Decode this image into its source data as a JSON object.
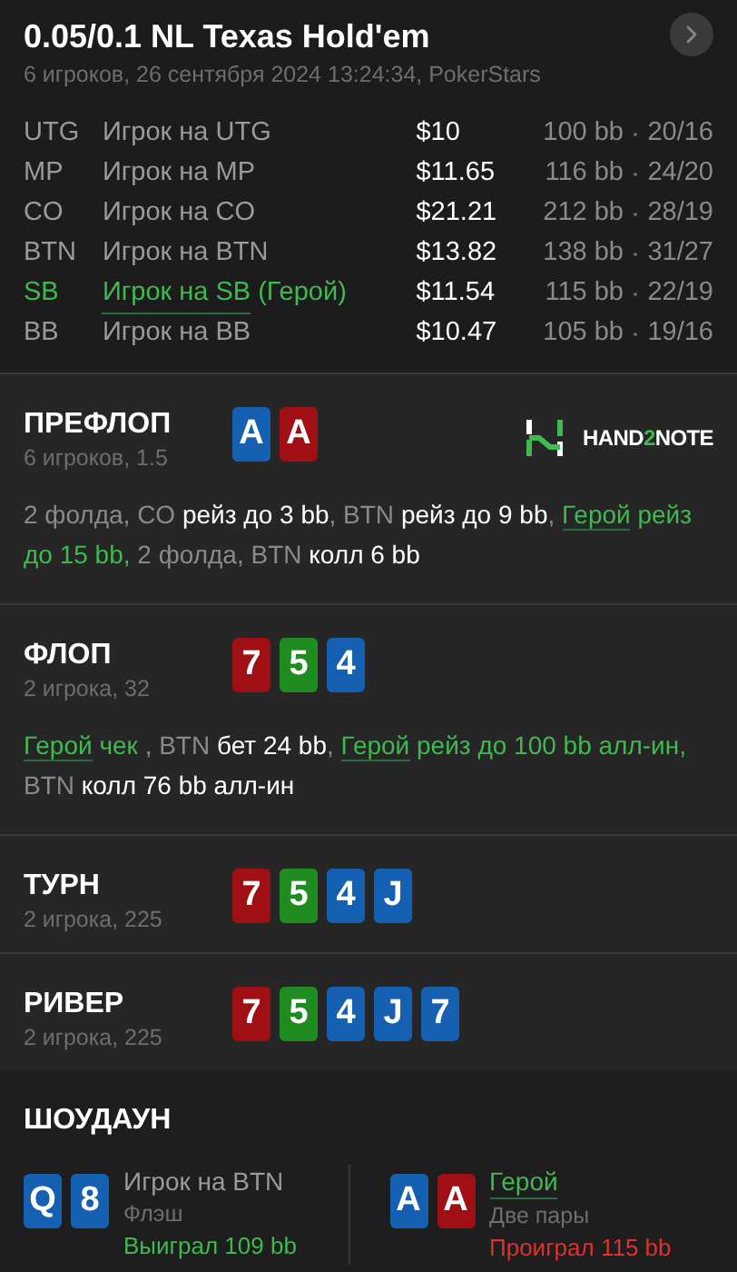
{
  "header": {
    "title": "0.05/0.1 NL Texas Hold'em",
    "subtitle": "6 игроков, 26 сентября 2024 13:24:34, PokerStars"
  },
  "players": [
    {
      "position": "UTG",
      "name": "Игрок на UTG",
      "stack": "$10",
      "bb": "100 bb",
      "stats": "20/16",
      "hero": false
    },
    {
      "position": "MP",
      "name": "Игрок на MP",
      "stack": "$11.65",
      "bb": "116 bb",
      "stats": "24/20",
      "hero": false
    },
    {
      "position": "CO",
      "name": "Игрок на CO",
      "stack": "$21.21",
      "bb": "212 bb",
      "stats": "28/19",
      "hero": false
    },
    {
      "position": "BTN",
      "name": "Игрок на BTN",
      "stack": "$13.82",
      "bb": "138 bb",
      "stats": "31/27",
      "hero": false
    },
    {
      "position": "SB",
      "name": "Игрок на SB",
      "suffix": "(Герой)",
      "stack": "$11.54",
      "bb": "115 bb",
      "stats": "22/19",
      "hero": true
    },
    {
      "position": "BB",
      "name": "Игрок на BB",
      "stack": "$10.47",
      "bb": "105 bb",
      "stats": "19/16",
      "hero": false
    }
  ],
  "streets": [
    {
      "title": "ПРЕФЛОП",
      "info": "6 игроков, 1.5",
      "logo": {
        "parts": [
          {
            "text": "HAND",
            "accent": false
          },
          {
            "text": "2",
            "accent": true
          },
          {
            "text": "NOTE",
            "accent": false
          }
        ]
      },
      "cards": [
        {
          "rank": "A",
          "color": "#1560b0"
        },
        {
          "rank": "A",
          "color": "#a00f14"
        }
      ],
      "actions": [
        {
          "kind": "actor",
          "text": "2 фолда, CO "
        },
        {
          "kind": "action",
          "text": "рейз до 3 bb"
        },
        {
          "kind": "actor",
          "text": ", BTN "
        },
        {
          "kind": "action",
          "text": "рейз до 9 bb"
        },
        {
          "kind": "actor",
          "text": ", "
        },
        {
          "kind": "hero",
          "text": "Герой"
        },
        {
          "kind": "hero_action",
          "text": " рейз до 15 bb,"
        },
        {
          "kind": "actor",
          "text": " 2 фолда, BTN "
        },
        {
          "kind": "action",
          "text": "колл 6 bb"
        }
      ]
    },
    {
      "title": "ФЛОП",
      "info": "2 игрока, 32",
      "cards": [
        {
          "rank": "7",
          "color": "#a00f14"
        },
        {
          "rank": "5",
          "color": "#1e8c1e"
        },
        {
          "rank": "4",
          "color": "#1560b0"
        }
      ],
      "actions": [
        {
          "kind": "hero",
          "text": "Герой"
        },
        {
          "kind": "hero_action",
          "text": " чек "
        },
        {
          "kind": "actor",
          "text": ", BTN "
        },
        {
          "kind": "action",
          "text": "бет 24 bb"
        },
        {
          "kind": "actor",
          "text": ", "
        },
        {
          "kind": "hero",
          "text": "Герой"
        },
        {
          "kind": "hero_action",
          "text": " рейз до 100 bb алл-ин,"
        },
        {
          "kind": "actor",
          "text": " BTN "
        },
        {
          "kind": "action",
          "text": "колл 76 bb алл-ин"
        }
      ]
    },
    {
      "title": "ТУРН",
      "info": "2 игрока, 225",
      "cards": [
        {
          "rank": "7",
          "color": "#a00f14"
        },
        {
          "rank": "5",
          "color": "#1e8c1e"
        },
        {
          "rank": "4",
          "color": "#1560b0"
        },
        {
          "rank": "J",
          "color": "#1560b0"
        }
      ]
    },
    {
      "title": "РИВЕР",
      "info": "2 игрока, 225",
      "cards": [
        {
          "rank": "7",
          "color": "#a00f14"
        },
        {
          "rank": "5",
          "color": "#1e8c1e"
        },
        {
          "rank": "4",
          "color": "#1560b0"
        },
        {
          "rank": "J",
          "color": "#1560b0"
        },
        {
          "rank": "7",
          "color": "#1560b0"
        }
      ]
    }
  ],
  "showdown": {
    "title": "ШОУДАУН",
    "players": [
      {
        "name": "Игрок на BTN",
        "hero": false,
        "hand": "Флэш",
        "result": "Выиграл 109 bb",
        "won": true,
        "cards": [
          {
            "rank": "Q",
            "color": "#1560b0"
          },
          {
            "rank": "8",
            "color": "#1560b0"
          }
        ]
      },
      {
        "name": "Герой",
        "hero": true,
        "hand": "Две пары",
        "result": "Проиграл 115 bb",
        "won": false,
        "cards": [
          {
            "rank": "A",
            "color": "#1560b0"
          },
          {
            "rank": "A",
            "color": "#a00f14"
          }
        ]
      }
    ]
  }
}
